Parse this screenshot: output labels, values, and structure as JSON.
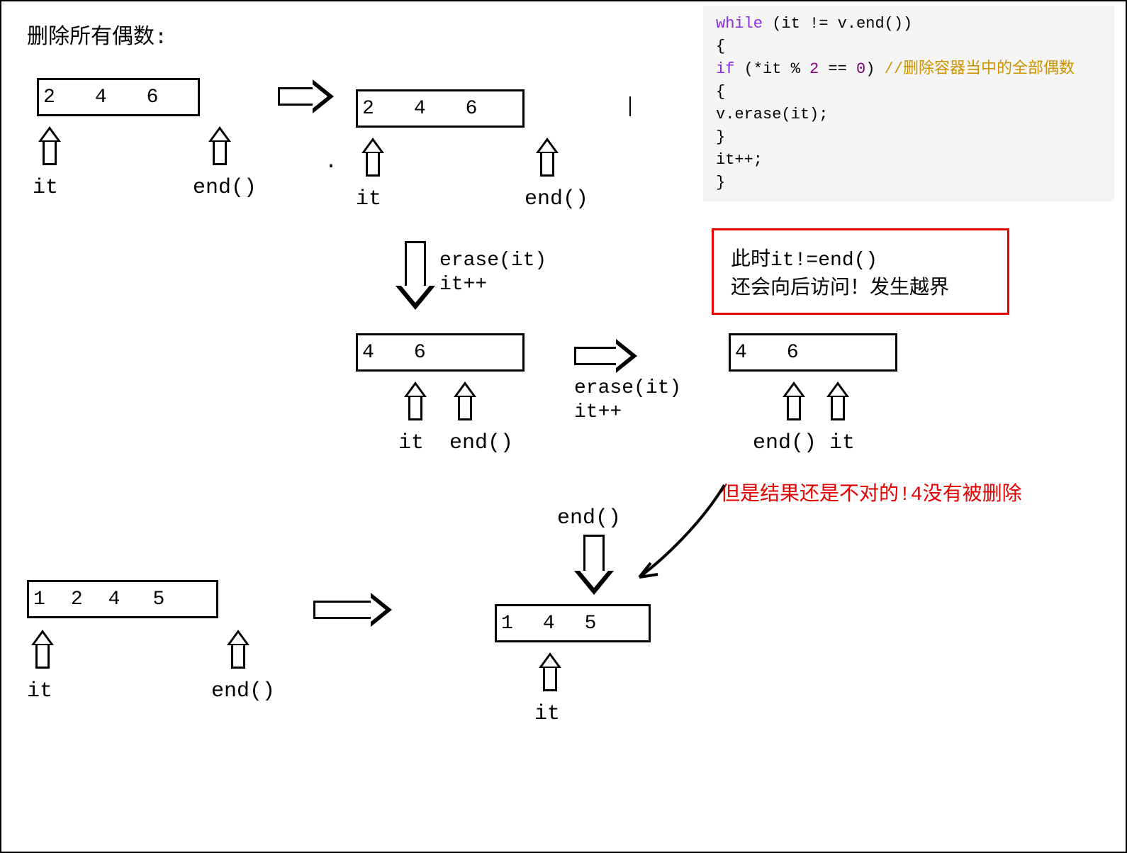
{
  "title": "删除所有偶数:",
  "arrays": {
    "a1": [
      "2",
      "4",
      "6"
    ],
    "a2": [
      "2",
      "4",
      "6"
    ],
    "a3": [
      "4",
      "6"
    ],
    "a4": [
      "4",
      "6"
    ],
    "a5": [
      "1",
      "2",
      "4",
      "5"
    ],
    "a6": [
      "1",
      "4",
      "5"
    ]
  },
  "labels": {
    "it": "it",
    "end": "end()",
    "erase_it": "erase(it)",
    "itpp": "it++",
    "end_space_it": "end() it"
  },
  "redbox": {
    "line1": "此时it!=end()",
    "line2": "还会向后访问！发生越界"
  },
  "red_note": "但是结果还是不对的!4没有被删除",
  "dot": ".",
  "code": {
    "l1a": "while",
    "l1b": " (it != v.end())",
    "l2": "{",
    "l3a": "    ",
    "l3b": "if",
    "l3c": " (*it % ",
    "l3d": "2",
    "l3e": " == ",
    "l3f": "0",
    "l3g": ") ",
    "l3h": "//删除容器当中的全部偶数",
    "l4": "    {",
    "l5": "        v.erase(it);",
    "l6": "    }",
    "l7": "    it++;",
    "l8": "}"
  }
}
